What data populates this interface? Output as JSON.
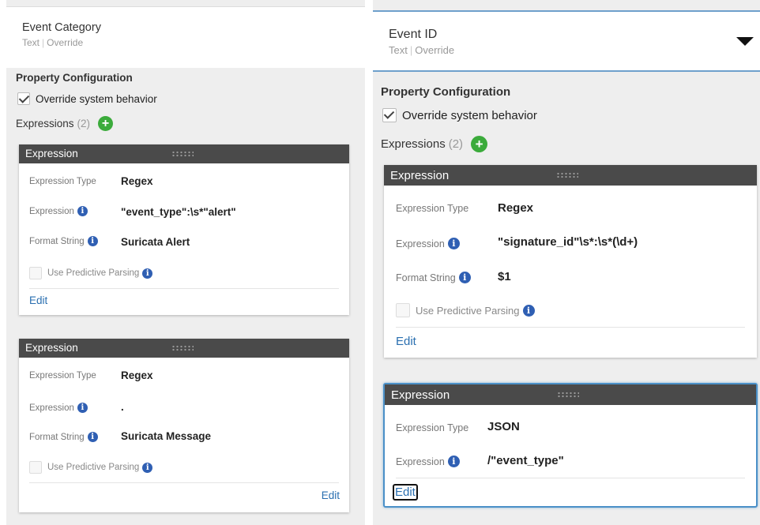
{
  "left": {
    "property": {
      "name": "Event Category",
      "type": "Text",
      "mode": "Override"
    },
    "config_title": "Property Configuration",
    "override_label": "Override system behavior",
    "override_checked": true,
    "expressions_label": "Expressions",
    "expressions_count": "(2)",
    "add_symbol": "+",
    "cards": [
      {
        "title": "Expression",
        "type_label": "Expression Type",
        "type_value": "Regex",
        "expr_label": "Expression",
        "expr_value": "\"event_type\":\\s*\"alert\"",
        "format_label": "Format String",
        "format_value": "Suricata Alert",
        "pp_label": "Use Predictive Parsing",
        "edit_label": "Edit"
      },
      {
        "title": "Expression",
        "type_label": "Expression Type",
        "type_value": "Regex",
        "expr_label": "Expression",
        "expr_value": ".",
        "format_label": "Format String",
        "format_value": "Suricata Message",
        "pp_label": "Use Predictive Parsing",
        "edit_label": "Edit"
      }
    ]
  },
  "right": {
    "property": {
      "name": "Event ID",
      "type": "Text",
      "mode": "Override"
    },
    "config_title": "Property Configuration",
    "override_label": "Override system behavior",
    "override_checked": true,
    "expressions_label": "Expressions",
    "expressions_count": "(2)",
    "add_symbol": "+",
    "cards": [
      {
        "title": "Expression",
        "type_label": "Expression Type",
        "type_value": "Regex",
        "expr_label": "Expression",
        "expr_value": "\"signature_id\"\\s*:\\s*(\\d+)",
        "format_label": "Format String",
        "format_value": "$1",
        "pp_label": "Use Predictive Parsing",
        "edit_label": "Edit"
      },
      {
        "title": "Expression",
        "type_label": "Expression Type",
        "type_value": "JSON",
        "expr_label": "Expression",
        "expr_value": "/\"event_type\"",
        "edit_label": "Edit"
      }
    ]
  },
  "icons": {
    "info": "info-icon",
    "add": "add-icon",
    "expand": "caret-down-icon",
    "drag": "drag-handle-icon"
  },
  "colors": {
    "header": "#4a4a4a",
    "link": "#2a6fb0",
    "add": "#3bab3b",
    "info": "#2f5fb3",
    "focus": "#4a90c8"
  }
}
